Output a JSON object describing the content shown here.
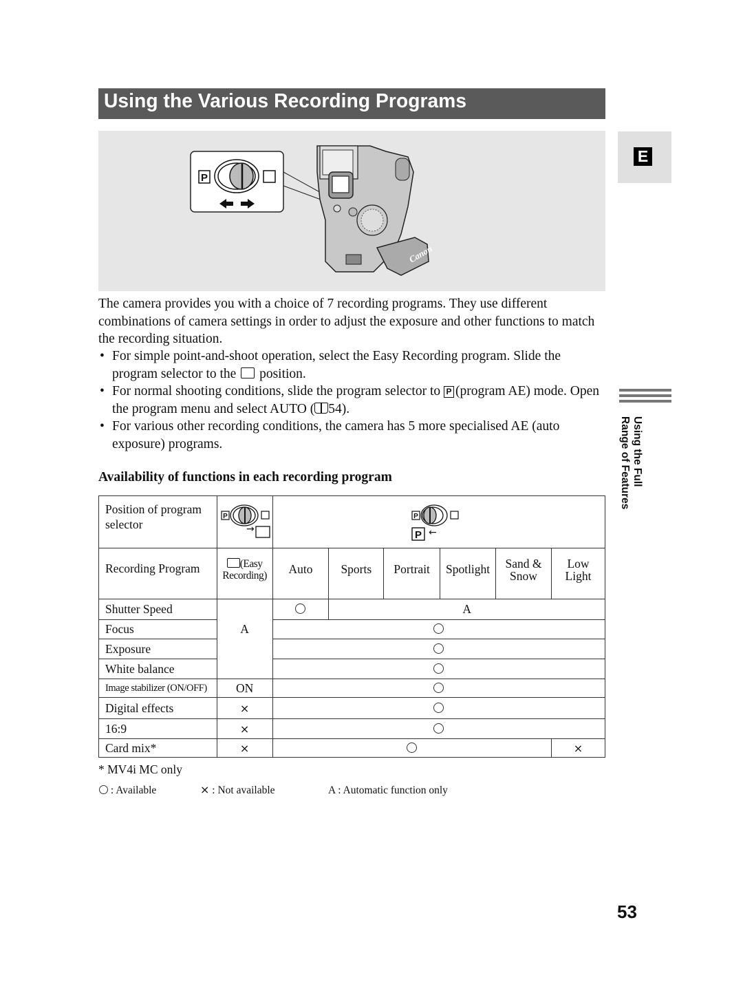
{
  "page": {
    "title": "Using the Various Recording Programs",
    "page_number": "53",
    "side_tab_letter": "E",
    "side_section": [
      "Using the Full",
      "Range of Features"
    ]
  },
  "figure": {
    "callout_left_symbol": "P",
    "brand_text": "Canon"
  },
  "intro": "The camera provides you with a choice of 7 recording programs. They use different combinations of camera settings in order to adjust the exposure and other functions to match the recording situation.",
  "bullets": [
    {
      "dot": "•",
      "before": "For simple point-and-shoot operation, select the Easy Recording program. Slide the program selector to the",
      "after": "position."
    },
    {
      "dot": "•",
      "before": "For normal shooting conditions, slide the program selector to",
      "symbol": "P",
      "after": "(program AE) mode. Open the program menu and select AUTO  (",
      "ref_icon": "book-icon",
      "ref": "54)."
    },
    {
      "dot": "•",
      "before": "For various other recording conditions, the camera has 5 more specialised AE (auto exposure) programs."
    }
  ],
  "subheading": "Availability of functions in each recording program",
  "table": {
    "row_header_selector": "Position of program selector",
    "row_header_program": "Recording Program",
    "selector_easy_arrow": "→",
    "selector_p_label": "P",
    "selector_p_arrow": "←",
    "easy_program": [
      "(Easy",
      "Recording)"
    ],
    "programs": [
      "Auto",
      "Sports",
      "Portrait",
      "Spotlight",
      "Sand & Snow",
      "Low Light"
    ],
    "rows": [
      {
        "label": "Shutter Speed",
        "easy": "A",
        "auto": "○",
        "others": "A"
      },
      {
        "label": "Focus",
        "easy": "A",
        "pae": "○"
      },
      {
        "label": "Exposure",
        "pae": "○"
      },
      {
        "label": "White balance",
        "pae": "○"
      },
      {
        "label": "Image stabilizer (ON/OFF)",
        "easy": "ON",
        "pae": "○"
      },
      {
        "label": "Digital effects",
        "easy": "×",
        "pae": "○"
      },
      {
        "label": "16:9",
        "easy": "×",
        "pae": "○"
      },
      {
        "label": "Card mix*",
        "easy": "×",
        "pae": "○",
        "low_light": "×"
      }
    ]
  },
  "footnote": "* MV4i MC only",
  "legend": [
    {
      "symbol": "○",
      "text": ": Available"
    },
    {
      "symbol": "×",
      "text": ": Not available"
    },
    {
      "symbol": "A",
      "text": ": Automatic function only"
    }
  ]
}
